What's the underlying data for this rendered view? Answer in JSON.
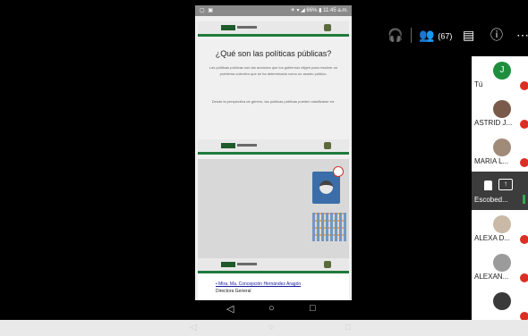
{
  "phone": {
    "status_left": "▢ ▣",
    "status_right": "✈ ▾ ◢ 66% ▮ 11:45 a.m.",
    "slide_title": "¿Qué son las políticas públicas?",
    "slide_body_1": "Las políticas públicas son las acciones que los gobiernos eligen para resolver un problema colectivo que se ha determinado como un asunto público.",
    "slide_body_2": "Desde la perspectiva de género, las políticas públicas pueden clasificarse en:",
    "footer_bullet": "•  Mtra. Ma. Concepción Hernández Aragón",
    "footer_role": "Directora General"
  },
  "nav": {
    "back": "◁",
    "home": "○",
    "recent": "□"
  },
  "toolbar": {
    "audio_icon": "🎧",
    "people_icon": "👥",
    "people_count": "(67)",
    "chat_icon": "▤",
    "info_icon": "ⓘ",
    "more_icon": "⋯"
  },
  "participants": [
    {
      "name": "Tú",
      "initial": "J"
    },
    {
      "name": "ASTRID J..."
    },
    {
      "name": "MARIA L..."
    },
    {
      "name": "Escobed..."
    },
    {
      "name": "ALEXA D..."
    },
    {
      "name": "ALEXAN..."
    },
    {
      "name": ""
    }
  ],
  "bottom": {
    "back": "◁",
    "home": "○",
    "recent": "□"
  }
}
